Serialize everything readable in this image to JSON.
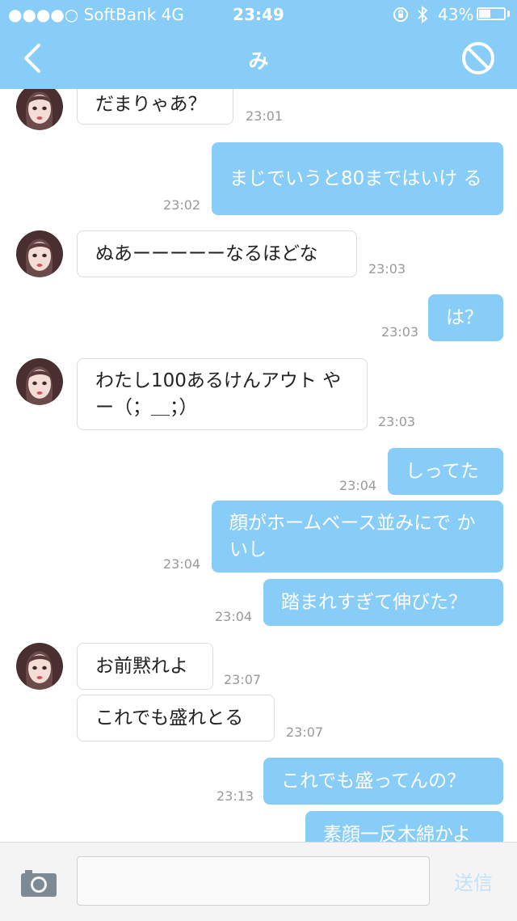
{
  "status_bar": {
    "carrier": "●●●●○ SoftBank   4G",
    "time": "23:49",
    "battery_text": "43%",
    "battery_level": 0.43,
    "icons": [
      "orientation-lock-icon",
      "bluetooth-icon",
      "battery-icon"
    ]
  },
  "header": {
    "title": "み",
    "back_icon": "chevron-left-icon",
    "block_icon": "block-icon",
    "background": "#88ccf8"
  },
  "messages": [
    {
      "side": "in",
      "text": "だまりゃあ？",
      "time": "23:01"
    },
    {
      "side": "out",
      "text": "まじでいうと80まではいけ る",
      "time": "23:02"
    },
    {
      "side": "in",
      "text": "ぬあーーーーーなるほどな",
      "time": "23:03"
    },
    {
      "side": "out",
      "text": "は？",
      "time": "23:03"
    },
    {
      "side": "in",
      "text": "わたし100あるけんアウト やー（；＿；）",
      "time": "23:03"
    },
    {
      "side": "out",
      "text": "しってた",
      "time": "23:04"
    },
    {
      "side": "out",
      "text": "顔がホームベース並みにで かいし",
      "time": "23:04"
    },
    {
      "side": "out",
      "text": "踏まれすぎて伸びた？",
      "time": "23:04"
    },
    {
      "side": "in",
      "text": "お前黙れよ",
      "time": "23:07"
    },
    {
      "side": "in",
      "text": "これでも盛れとる",
      "time": "23:07"
    },
    {
      "side": "out",
      "text": "これでも盛ってんの？",
      "time": "23:13"
    },
    {
      "side": "out",
      "text": "素顔一反木綿かよ",
      "time": ""
    }
  ],
  "composer": {
    "camera_icon": "camera-icon",
    "input_value": "",
    "input_placeholder": "",
    "send_label": "送信"
  },
  "colors": {
    "outgoing_bubble": "#88ccf8",
    "incoming_bubble": "#ffffff",
    "timestamp": "#999999"
  }
}
